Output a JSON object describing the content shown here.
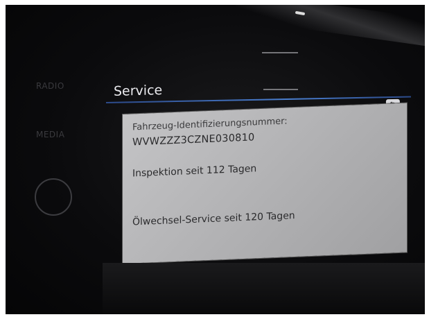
{
  "left_menu": {
    "items": [
      {
        "label": "RADIO"
      },
      {
        "label": "MEDIA"
      }
    ]
  },
  "screen": {
    "title": "Service",
    "back_icon": "return-arrow-icon",
    "back_glyph": "⮌"
  },
  "service_info": {
    "vin_label": "Fahrzeug-Identifizierungsnummer:",
    "vin_value": "WVWZZZ3CZNE030810",
    "inspection": "Inspektion seit 112 Tagen",
    "oil_change": "Ölwechsel-Service seit 120 Tagen"
  },
  "colors": {
    "panel": "#b8b8ba",
    "accent_rule": "#4a7fd0",
    "background": "#0b0b0d"
  }
}
